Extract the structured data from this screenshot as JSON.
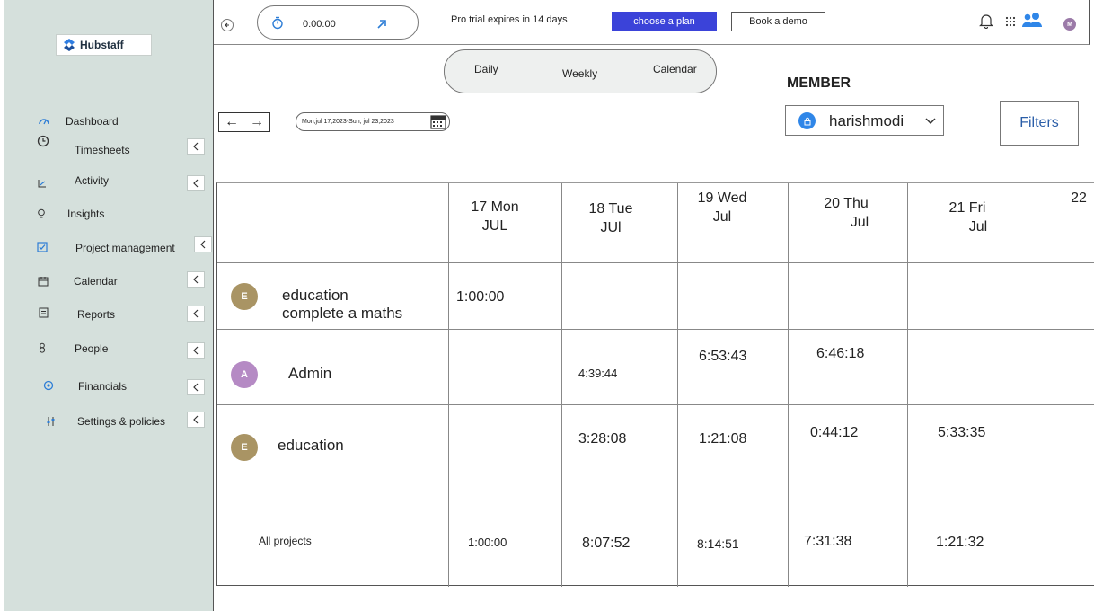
{
  "brand": {
    "name": "Hubstaff"
  },
  "sidebar": {
    "items": [
      {
        "label": "Dashboard",
        "icon": "dashboard-icon",
        "chevron": false
      },
      {
        "label": "Timesheets",
        "icon": "clock-icon",
        "chevron": true
      },
      {
        "label": "Activity",
        "icon": "activity-icon",
        "chevron": true
      },
      {
        "label": "Insights",
        "icon": "bulb-icon",
        "chevron": false
      },
      {
        "label": "Project management",
        "icon": "checkbox-icon",
        "chevron": true
      },
      {
        "label": "Calendar",
        "icon": "calendar-icon",
        "chevron": true
      },
      {
        "label": "Reports",
        "icon": "report-icon",
        "chevron": true
      },
      {
        "label": "People",
        "icon": "person-icon",
        "chevron": true
      },
      {
        "label": "Financials",
        "icon": "coin-icon",
        "chevron": true
      },
      {
        "label": "Settings & policies",
        "icon": "sliders-icon",
        "chevron": true
      }
    ]
  },
  "topbar": {
    "timer": "0:00:00",
    "trial_text": "Pro trial expires in 14 days",
    "plan_label": "choose a plan",
    "demo_label": "Book a demo",
    "user_initial": "M"
  },
  "views": {
    "daily": "Daily",
    "weekly": "Weekly",
    "calendar": "Calendar"
  },
  "date_range": "Mon,jul 17,2023-Sun, jul 23,2023",
  "member": {
    "title": "MEMBER",
    "selected": "harishmodi"
  },
  "filters_label": "Filters",
  "table": {
    "days": [
      {
        "num": "17",
        "name": "Mon",
        "month": "JUL"
      },
      {
        "num": "18",
        "name": "Tue",
        "month": "JUl"
      },
      {
        "num": "19",
        "name": "Wed",
        "month": "Jul"
      },
      {
        "num": "20",
        "name": "Thu",
        "month": "Jul"
      },
      {
        "num": "21",
        "name": "Fri",
        "month": "Jul"
      },
      {
        "num": "22",
        "name": "",
        "month": ""
      }
    ],
    "rows": [
      {
        "initial": "E",
        "name_line1": "education",
        "name_line2": "complete a maths",
        "times": [
          "1:00:00",
          "",
          "",
          "",
          ""
        ]
      },
      {
        "initial": "A",
        "name_line1": "Admin",
        "name_line2": "",
        "times": [
          "",
          "4:39:44",
          "6:53:43",
          "6:46:18",
          ""
        ]
      },
      {
        "initial": "E",
        "name_line1": "education",
        "name_line2": "",
        "times": [
          "",
          "3:28:08",
          "1:21:08",
          "0:44:12",
          "5:33:35"
        ]
      }
    ],
    "totals": {
      "label": "All projects",
      "times": [
        "1:00:00",
        "8:07:52",
        "8:14:51",
        "7:31:38",
        "1:21:32"
      ]
    }
  },
  "colors": {
    "sidebar_bg": "#d5e0dc",
    "accent": "#3b43d9",
    "avatar_e": "#a99464",
    "avatar_a": "#b58ac4"
  }
}
